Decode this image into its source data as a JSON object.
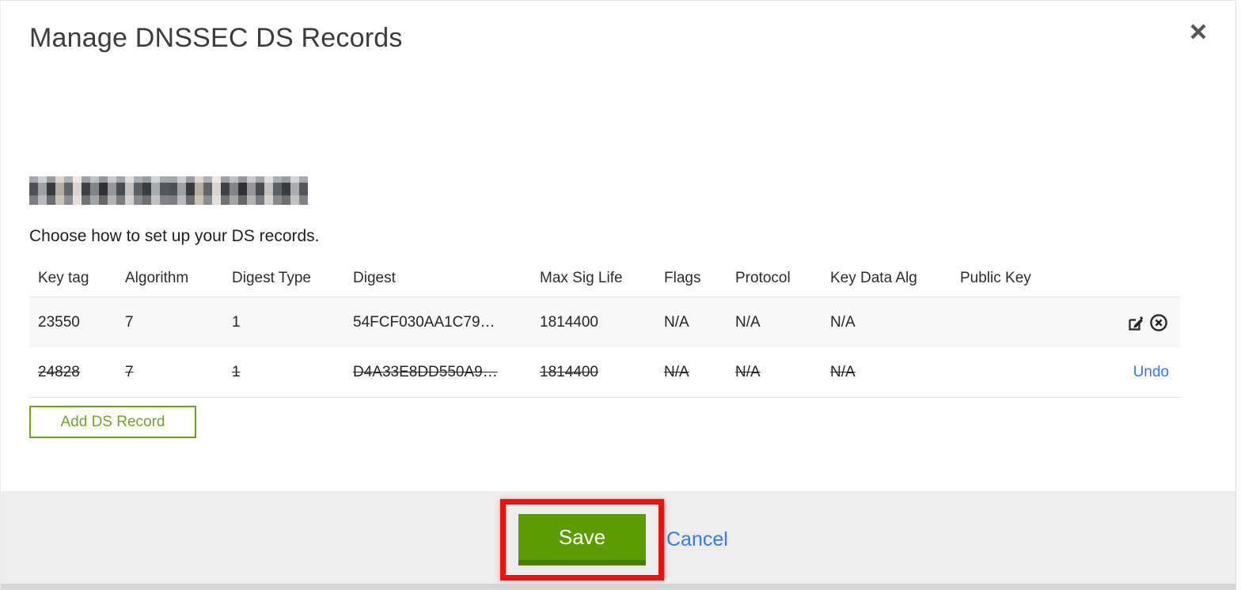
{
  "window": {
    "title": "Manage DNSSEC DS Records",
    "domain": {
      "redacted": true
    }
  },
  "instruction": "Choose how to set up your DS records.",
  "table": {
    "columns": [
      "Key tag",
      "Algorithm",
      "Digest Type",
      "Digest",
      "Max Sig Life",
      "Flags",
      "Protocol",
      "Key Data Alg",
      "Public Key"
    ],
    "rows": [
      {
        "key_tag": "23550",
        "algorithm": "7",
        "digest_type": "1",
        "digest": "54FCF030AA1C79…",
        "max_sig_life": "1814400",
        "flags": "N/A",
        "protocol": "N/A",
        "key_data_alg": "N/A",
        "public_key": "",
        "state": "current"
      },
      {
        "key_tag": "24828",
        "algorithm": "7",
        "digest_type": "1",
        "digest": "D4A33E8DD550A9…",
        "max_sig_life": "1814400",
        "flags": "N/A",
        "protocol": "N/A",
        "key_data_alg": "N/A",
        "public_key": "",
        "state": "deleted",
        "undo_label": "Undo"
      }
    ]
  },
  "buttons": {
    "add_ds_record": "Add DS Record",
    "save": "Save",
    "cancel": "Cancel"
  },
  "icons": {
    "close": "x-cross",
    "edit": "pencil-on-square",
    "remove": "circled-x"
  },
  "colors": {
    "save_green": "#5d9b02",
    "save_green_dark": "#4d7c03",
    "outline_green": "#6ba317",
    "link_blue": "#2e7af7",
    "annotation_red": "#ec130e",
    "footer_gray": "#ededed"
  }
}
